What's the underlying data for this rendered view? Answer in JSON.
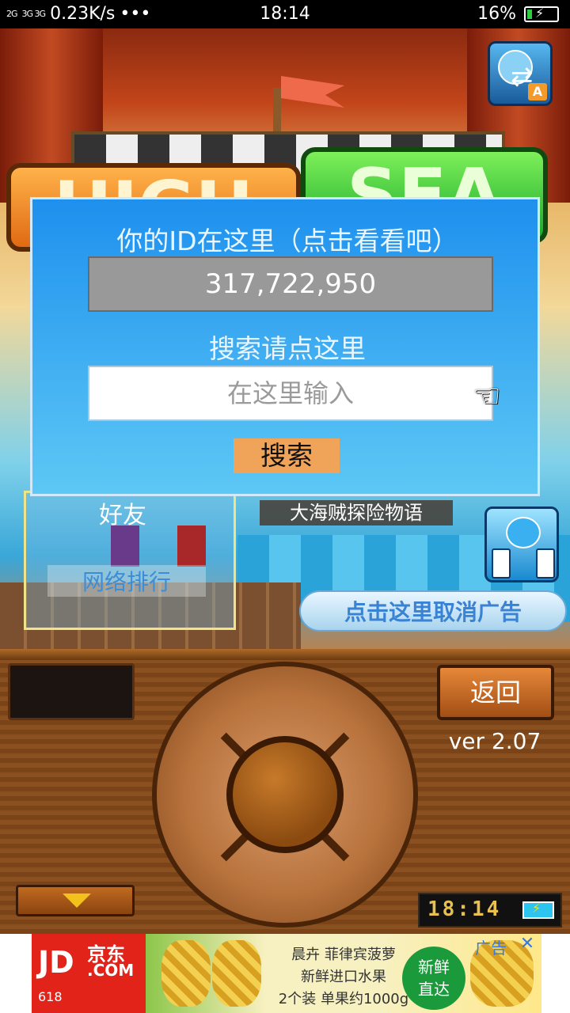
{
  "status_bar": {
    "signal_1": "2G",
    "signal_2": "3G 3G",
    "network_speed": "0.23K/s",
    "dots": "•••",
    "time": "18:14",
    "battery_percent": "16%",
    "battery_level": 0.16
  },
  "banner": {
    "left_text": "HIGH",
    "right_text": "SEA"
  },
  "dialog": {
    "title": "你的ID在这里（点击看看吧）",
    "user_id": "317,722,950",
    "search_prompt": "搜索请点这里",
    "search_placeholder": "在这里输入",
    "search_value": "",
    "search_button": "搜索"
  },
  "scene": {
    "friends_label": "好友",
    "ranking_label": "网络排行",
    "game_title": "大海贼探险物语",
    "remove_ads": "点击这里取消广告"
  },
  "controls": {
    "back_button": "返回",
    "version": "ver 2.07",
    "clock": "18:14"
  },
  "ad": {
    "brand_logo": "JD",
    "brand_cn": "京东",
    "brand_com": ".COM",
    "promo_618": "618",
    "line1": "晨卉 菲律宾菠萝",
    "line2": "新鲜进口水果",
    "line3": "2个装 单果约1000g",
    "badge_line1": "新鲜",
    "badge_line2": "直达",
    "tag": "广告",
    "close": "✕"
  }
}
